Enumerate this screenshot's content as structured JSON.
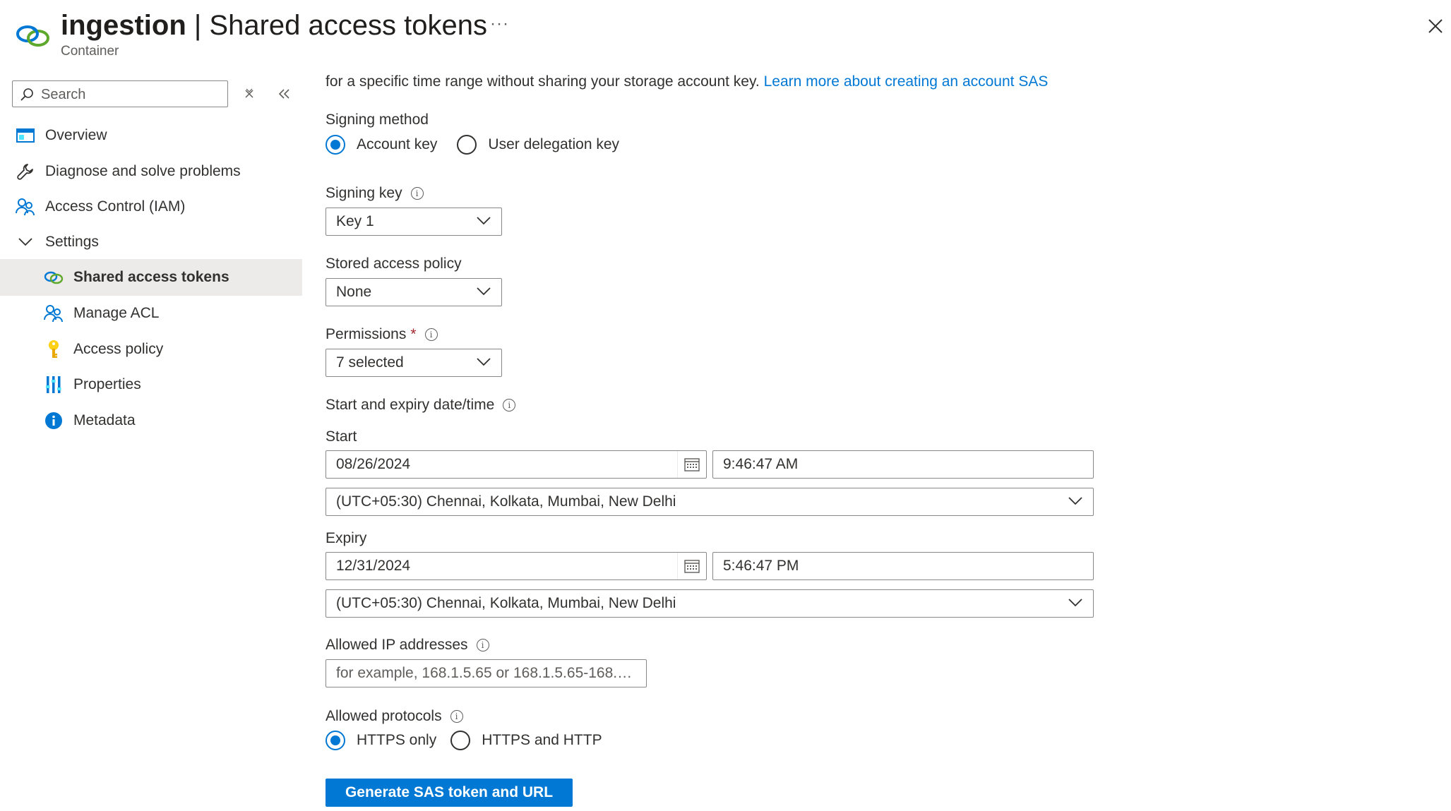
{
  "header": {
    "resource_name": "ingestion",
    "separator": " | ",
    "page_title": "Shared access tokens",
    "resource_type": "Container",
    "more_label": "···",
    "icon": "shared-access-link-icon"
  },
  "sidebar": {
    "search_placeholder": "Search",
    "items": [
      {
        "label": "Overview",
        "icon": "overview-icon"
      },
      {
        "label": "Diagnose and solve problems",
        "icon": "wrench-icon"
      },
      {
        "label": "Access Control (IAM)",
        "icon": "people-icon"
      },
      {
        "label": "Settings",
        "icon": "chevron-down-icon"
      },
      {
        "label": "Shared access tokens",
        "icon": "link-icon",
        "active": true
      },
      {
        "label": "Manage ACL",
        "icon": "people-icon"
      },
      {
        "label": "Access policy",
        "icon": "key-icon"
      },
      {
        "label": "Properties",
        "icon": "properties-icon"
      },
      {
        "label": "Metadata",
        "icon": "info-icon"
      }
    ]
  },
  "main": {
    "intro_text": "for a specific time range without sharing your storage account key. ",
    "intro_link": "Learn more about creating an account SAS",
    "signing_method": {
      "label": "Signing method",
      "options": [
        "Account key",
        "User delegation key"
      ],
      "selected": "Account key"
    },
    "signing_key": {
      "label": "Signing key",
      "value": "Key 1"
    },
    "stored_access_policy": {
      "label": "Stored access policy",
      "value": "None"
    },
    "permissions": {
      "label": "Permissions",
      "required_mark": "*",
      "value": "7 selected"
    },
    "date_section_label": "Start and expiry date/time",
    "start": {
      "label": "Start",
      "date": "08/26/2024",
      "time": "9:46:47 AM",
      "timezone": "(UTC+05:30) Chennai, Kolkata, Mumbai, New Delhi"
    },
    "expiry": {
      "label": "Expiry",
      "date": "12/31/2024",
      "time": "5:46:47 PM",
      "timezone": "(UTC+05:30) Chennai, Kolkata, Mumbai, New Delhi"
    },
    "allowed_ip": {
      "label": "Allowed IP addresses",
      "placeholder": "for example, 168.1.5.65 or 168.1.5.65-168.1...."
    },
    "allowed_protocols": {
      "label": "Allowed protocols",
      "options": [
        "HTTPS only",
        "HTTPS and HTTP"
      ],
      "selected": "HTTPS only"
    },
    "generate_button": "Generate SAS token and URL"
  },
  "colors": {
    "accent": "#0078d4",
    "active_nav_bg": "#edebe9",
    "required": "#a4262c"
  }
}
